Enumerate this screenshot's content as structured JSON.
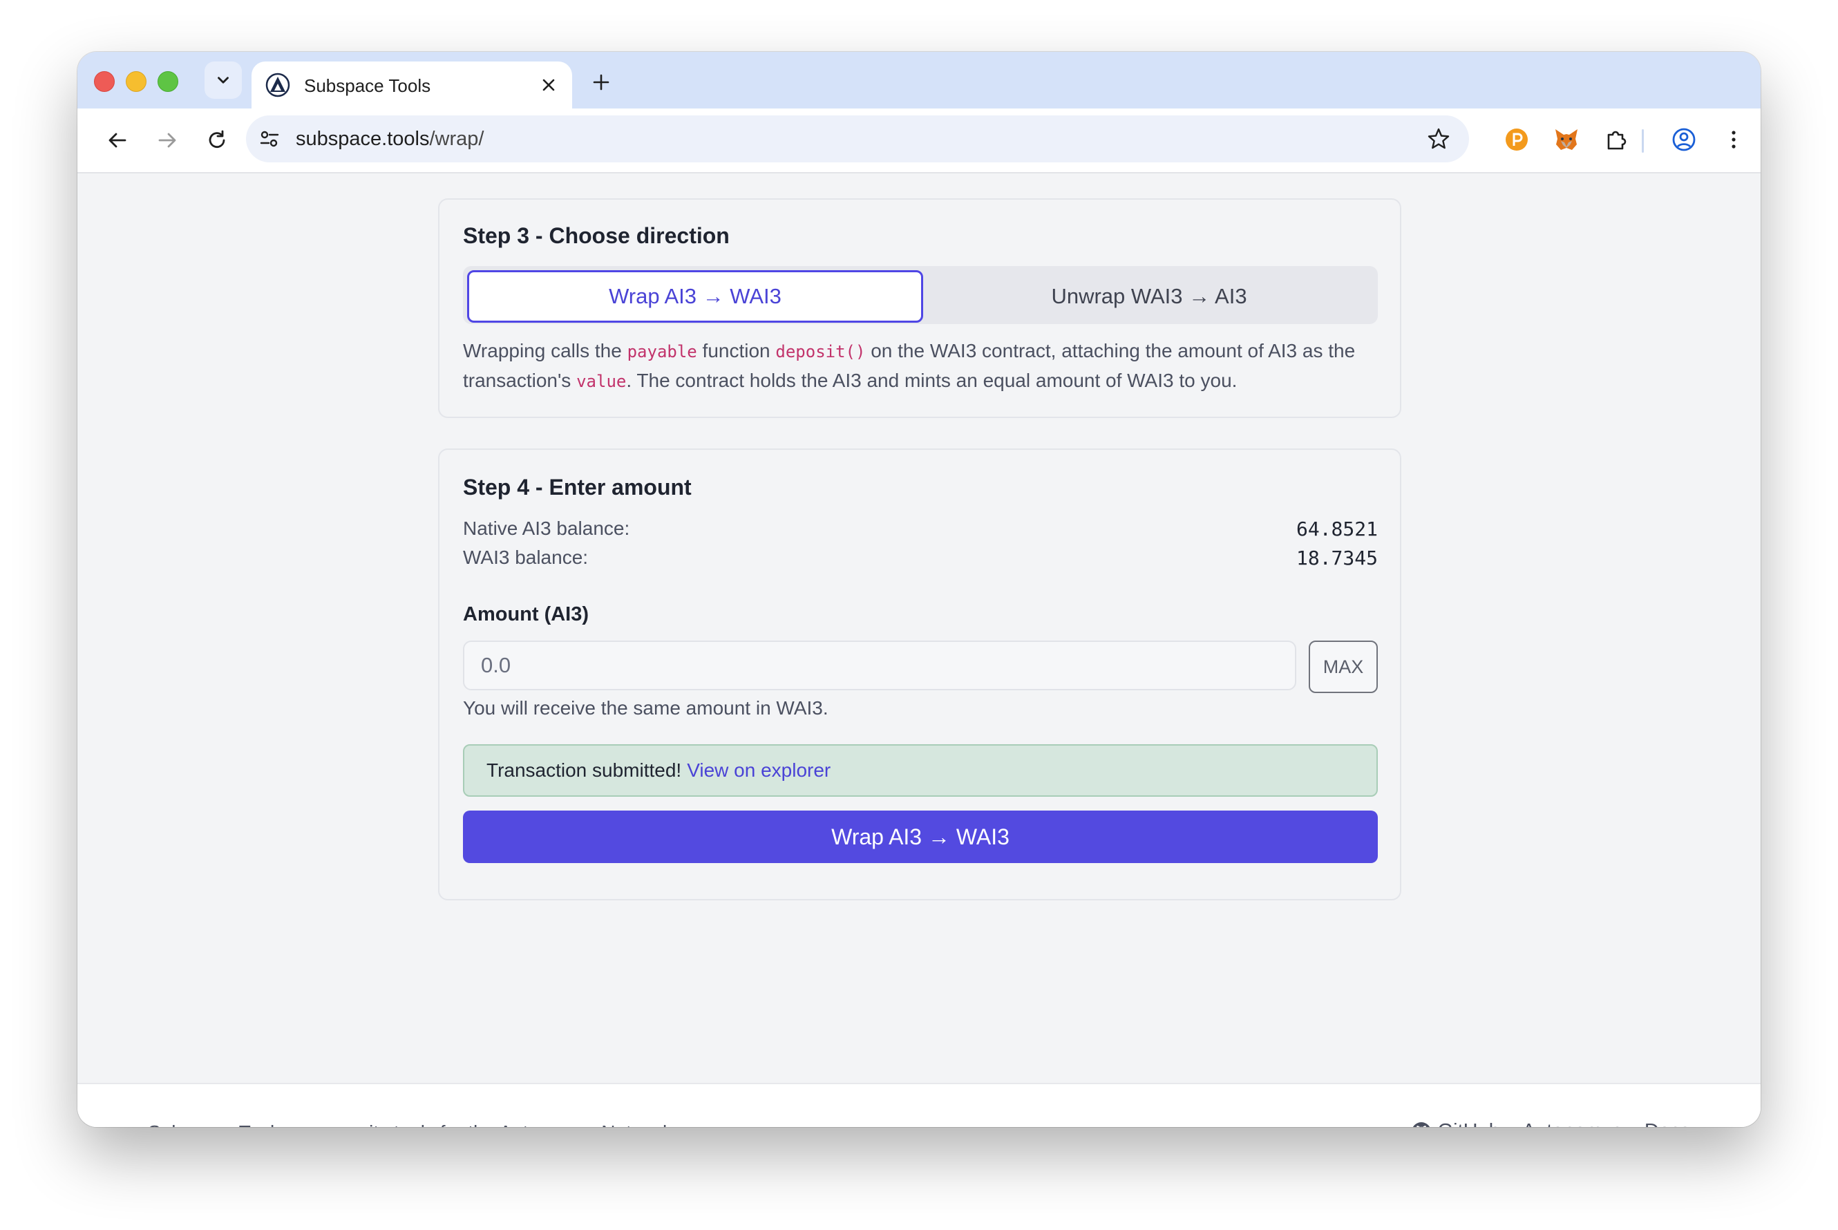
{
  "browser": {
    "tab_title": "Subspace Tools",
    "url_host": "subspace.tools",
    "url_path": "/wrap/"
  },
  "step3": {
    "title": "Step 3 - Choose direction",
    "option_wrap": "Wrap AI3 → WAI3",
    "option_unwrap": "Unwrap WAI3 → AI3",
    "selected": "wrap",
    "desc_1": "Wrapping calls the ",
    "code_payable": "payable",
    "desc_2": " function ",
    "code_deposit": "deposit()",
    "desc_3": " on the WAI3 contract, attaching the amount of AI3 as the transaction's ",
    "code_value": "value",
    "desc_4": ". The contract holds the AI3 and mints an equal amount of WAI3 to you."
  },
  "step4": {
    "title": "Step 4 - Enter amount",
    "native_label": "Native AI3 balance:",
    "native_value": "64.8521",
    "wai3_label": "WAI3 balance:",
    "wai3_value": "18.7345",
    "amount_label": "Amount (AI3)",
    "amount_placeholder": "0.0",
    "max_label": "MAX",
    "hint": "You will receive the same amount in WAI3.",
    "alert_text": "Transaction submitted!",
    "alert_link": "View on explorer",
    "submit_label": "Wrap AI3 → WAI3"
  },
  "footer": {
    "text": "Subspace Tools, community tools for the Autonomys Network.",
    "links": [
      "GitHub",
      "Autonomys",
      "Docs"
    ]
  },
  "colors": {
    "accent": "#534ae0",
    "success_bg": "#d6e7de",
    "tabstrip": "#d5e2f9"
  }
}
